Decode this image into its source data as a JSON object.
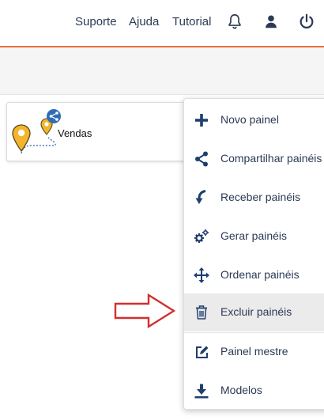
{
  "topnav": {
    "links": [
      "Suporte",
      "Ajuda",
      "Tutorial"
    ]
  },
  "card": {
    "title": "Vendas"
  },
  "menu": {
    "items": [
      {
        "label": "Novo painel",
        "icon": "plus-icon"
      },
      {
        "label": "Compartilhar painéis",
        "icon": "share-icon"
      },
      {
        "label": "Receber painéis",
        "icon": "receive-arrow-icon"
      },
      {
        "label": "Gerar painéis",
        "icon": "gears-icon"
      },
      {
        "label": "Ordenar painéis",
        "icon": "move-arrows-icon"
      },
      {
        "label": "Excluir painéis",
        "icon": "trash-icon"
      },
      {
        "label": "Painel mestre",
        "icon": "edit-icon"
      },
      {
        "label": "Modelos",
        "icon": "download-icon"
      }
    ]
  },
  "colors": {
    "accent": "#e8703a",
    "text": "#2b3a55",
    "icon": "#1f3f6e",
    "pin": "#f2b52b",
    "arrow": "#d32f2f"
  }
}
